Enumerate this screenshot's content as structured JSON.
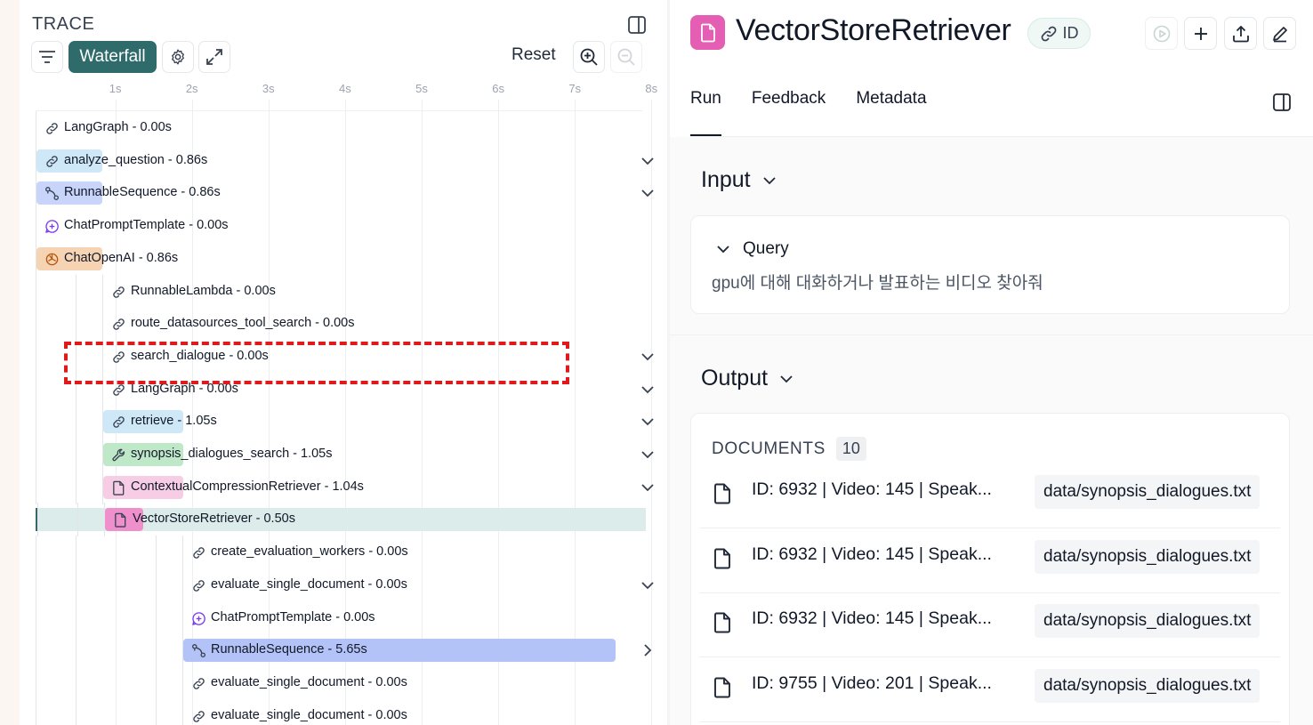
{
  "trace": {
    "title": "TRACE",
    "view_button": "Waterfall",
    "reset_label": "Reset",
    "axis_ticks": [
      "1s",
      "2s",
      "3s",
      "4s",
      "5s",
      "6s",
      "7s",
      "8s"
    ],
    "rows": [
      {
        "label": "LangGraph - 0.00s",
        "icon": "link-icon",
        "depth": 0,
        "bar": null,
        "chevron": null,
        "selected": false
      },
      {
        "label": "analyze_question - 0.86s",
        "icon": "link-icon",
        "depth": 0,
        "bar": {
          "color": "#cfe8f7",
          "start_s": 0,
          "duration_s": 0.86
        },
        "chevron": "down",
        "selected": false
      },
      {
        "label": "RunnableSequence - 0.86s",
        "icon": "sequence-icon",
        "depth": 0,
        "bar": {
          "color": "#c9d4fa",
          "start_s": 0,
          "duration_s": 0.86
        },
        "chevron": "down",
        "selected": false
      },
      {
        "label": "ChatPromptTemplate - 0.00s",
        "icon": "prompt-icon",
        "depth": 0,
        "bar": null,
        "chevron": null,
        "selected": false
      },
      {
        "label": "ChatOpenAI - 0.86s",
        "icon": "openai-icon",
        "depth": 0,
        "bar": {
          "color": "#f6d3b3",
          "start_s": 0,
          "duration_s": 0.86
        },
        "chevron": null,
        "selected": false
      },
      {
        "label": "RunnableLambda - 0.00s",
        "icon": "link-icon",
        "depth": 1,
        "bar": null,
        "chevron": null,
        "selected": false
      },
      {
        "label": "route_datasources_tool_search - 0.00s",
        "icon": "link-icon",
        "depth": 1,
        "bar": null,
        "chevron": null,
        "selected": false
      },
      {
        "label": "search_dialogue - 0.00s",
        "icon": "link-icon",
        "depth": 1,
        "bar": null,
        "chevron": "down",
        "selected": false
      },
      {
        "label": "LangGraph - 0.00s",
        "icon": "link-icon",
        "depth": 1,
        "bar": null,
        "chevron": "down",
        "selected": false
      },
      {
        "label": "retrieve - 1.05s",
        "icon": "link-icon",
        "depth": 1,
        "bar": {
          "color": "#cfe8f7",
          "start_s": 0.86,
          "duration_s": 1.05
        },
        "chevron": "down",
        "selected": false
      },
      {
        "label": "synopsis_dialogues_search - 1.05s",
        "icon": "wrench-icon",
        "depth": 1,
        "bar": {
          "color": "#bfe8c8",
          "start_s": 0.86,
          "duration_s": 1.05
        },
        "chevron": "down",
        "selected": false
      },
      {
        "label": "ContextualCompressionRetriever - 1.04s",
        "icon": "file-icon",
        "depth": 1,
        "bar": {
          "color": "#f7cde6",
          "start_s": 0.86,
          "duration_s": 1.04
        },
        "chevron": "down",
        "selected": false
      },
      {
        "label": "VectorStoreRetriever - 0.50s",
        "icon": "file-icon",
        "depth": 1,
        "bar": {
          "color": "#ef8fcc",
          "start_s": 0.86,
          "duration_s": 0.5
        },
        "chevron": null,
        "selected": true
      },
      {
        "label": "create_evaluation_workers - 0.00s",
        "icon": "link-icon",
        "depth": 2,
        "bar": null,
        "chevron": null,
        "selected": false
      },
      {
        "label": "evaluate_single_document - 0.00s",
        "icon": "link-icon",
        "depth": 2,
        "bar": null,
        "chevron": "down",
        "selected": false
      },
      {
        "label": "ChatPromptTemplate - 0.00s",
        "icon": "prompt-icon",
        "depth": 2,
        "bar": null,
        "chevron": null,
        "selected": false
      },
      {
        "label": "RunnableSequence - 5.65s",
        "icon": "sequence-icon",
        "depth": 2,
        "bar": {
          "color": "#b4c3f7",
          "start_s": 1.91,
          "duration_s": 5.65
        },
        "chevron": "right",
        "selected": false
      },
      {
        "label": "evaluate_single_document - 0.00s",
        "icon": "link-icon",
        "depth": 2,
        "bar": null,
        "chevron": null,
        "selected": false
      },
      {
        "label": "evaluate_single_document - 0.00s",
        "icon": "link-icon",
        "depth": 2,
        "bar": null,
        "chevron": null,
        "selected": false
      }
    ]
  },
  "detail": {
    "run_name": "VectorStoreRetriever",
    "id_badge": "ID",
    "tabs": [
      "Run",
      "Feedback",
      "Metadata"
    ],
    "active_tab": "Run",
    "input": {
      "title": "Input",
      "query_label": "Query",
      "query_value": "gpu에 대해 대화하거나 발표하는 비디오 찾아줘"
    },
    "output": {
      "title": "Output",
      "documents_label": "DOCUMENTS",
      "documents_count": "10",
      "documents": [
        {
          "text": "ID: 6932 | Video: 145 | Speak...",
          "source": "data/synopsis_dialogues.txt"
        },
        {
          "text": "ID: 6932 | Video: 145 | Speak...",
          "source": "data/synopsis_dialogues.txt"
        },
        {
          "text": "ID: 6932 | Video: 145 | Speak...",
          "source": "data/synopsis_dialogues.txt"
        },
        {
          "text": "ID: 9755 | Video: 201 | Speak...",
          "source": "data/synopsis_dialogues.txt"
        }
      ]
    }
  },
  "colors": {
    "accent": "#2f6b6b",
    "selected_row": "#dcecea",
    "run_icon": "#e45fb3",
    "highlight": "#e0191b"
  }
}
